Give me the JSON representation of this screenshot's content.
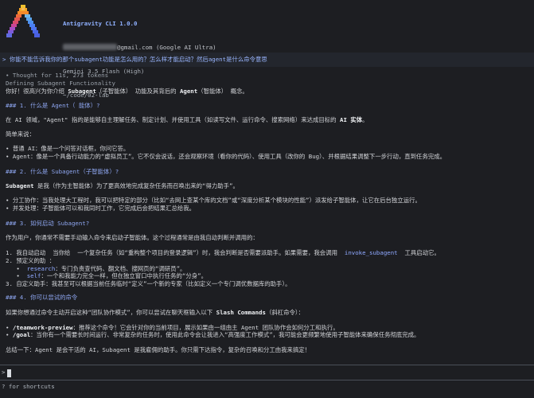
{
  "header": {
    "app_title": "Antigravity CLI 1.0.0",
    "email_suffix": "@gmail.com (Google AI Ultra)",
    "model": "Gemini 3.5 Flash (High)",
    "cwd": "~/code/02-lab"
  },
  "user_prompt": "> 你能不能告诉我你的那个subagent功能是怎么用的？怎么样才能启动？然后agent是什么命令意思",
  "thinking": {
    "line1": "• Thought for 11s, 273 tokens",
    "line2": "Defining Subagent Functionality"
  },
  "answer": {
    "intro_a": "你好！很高兴为你介绍 ",
    "intro_b": "Subagent",
    "intro_c": "（子智能体） 功能及其背后的 ",
    "intro_d": "Agent",
    "intro_e": "（智能体） 概念。",
    "h1": "### 1. 什么是 Agent（ 能体）?",
    "p1_a": "在 AI 领域，\"Agent\" 指的是能够自主理解任务、制定计划、并使用工具（如读写文件、运行命令、搜索网络）来达成目标的 ",
    "p1_b": "AI 实体",
    "p1_c": "。",
    "simple": "简单来说：",
    "b1": "• 普通 AI：像是一个问答对话框，你问它答。",
    "b2": "• Agent：像是一个具备行动能力的“虚拟员工”。它不仅会说话，还会观察环境（看你的代码）、使用工具（改你的 Bug）、并根据结果调整下一步行动，直到任务完成。",
    "h2": "### 2. 什么是 Subagent（子智能体）?",
    "p2_a": "Subagent",
    "p2_b": " 是我（作为主智能体）为了更高效地完成复杂任务而召唤出来的“得力助手”。",
    "b3": "• 分工协作：当我处理大工程时，我可以把特定的部分（比如“去网上查某个库的文档”或“深度分析某个模块的性能”）派发给子智能体，让它在后台独立运行。",
    "b4": "• 并发处理：子智能体可以和我同时工作，它完成后会把结果汇总给我。",
    "h3": "### 3. 如何启动 Subagent?",
    "p3": "作为用户，你通常不需要手动输入命令来启动子智能体。这个过程通常是由我自动判断并调用的：",
    "n1_a": "1. 我自动启动  当你给  一个复杂任务（如“重构整个项目的登录逻辑”）时，我会判断是否需要派助手。如果需要，我会调用  ",
    "n1_b": "invoke_subagent",
    "n1_c": "  工具启动它。",
    "n2": "2. 预定义的助 ：",
    "n2_i1_a": "   •  ",
    "n2_i1_b": "research",
    "n2_i1_c": "：专门负责查代码、翻文档、搜网页的“调研员”。",
    "n2_i2_a": "   •  ",
    "n2_i2_b": "self",
    "n2_i2_c": "：一个和我能力完全一样，但在独立窗口中执行任务的“分身”。",
    "n3": "3. 自定义助手：我甚至可以根据当前任务临时“定义”一个新的专家（比如定义一个专门调优数据库的助手）。",
    "h4": "### 4. 你可以尝试的命令",
    "p4_a": "如果你想通过命令主动开启这种“团队协作模式”，你可以尝试在聊天框输入以下 ",
    "p4_b": "Slash Commands",
    "p4_c": "（斜杠命令）：",
    "c1_a": "• ",
    "c1_b": "/teamwork-preview",
    "c1_c": "：推荐这个命令！它会针对你的当前项目，展示如果由一组由主 Agent 团队协作会如何分工和执行。",
    "c2_a": "• ",
    "c2_b": "/goal",
    "c2_c": "：当你有一个需要长时间运行、非常复杂的任务时，使用此命令会让我进入“高强度工作模式”，我可能会更频繁地使用子智能体来确保任务彻底完成。",
    "summary": "总结一下：Agent 是会干活的 AI，Subagent 是我雇佣的助手。你只需下达指令，复杂的召唤和分工由我来搞定！"
  },
  "input": {
    "caret": ">"
  },
  "footer": {
    "shortcuts": "? for shortcuts"
  }
}
